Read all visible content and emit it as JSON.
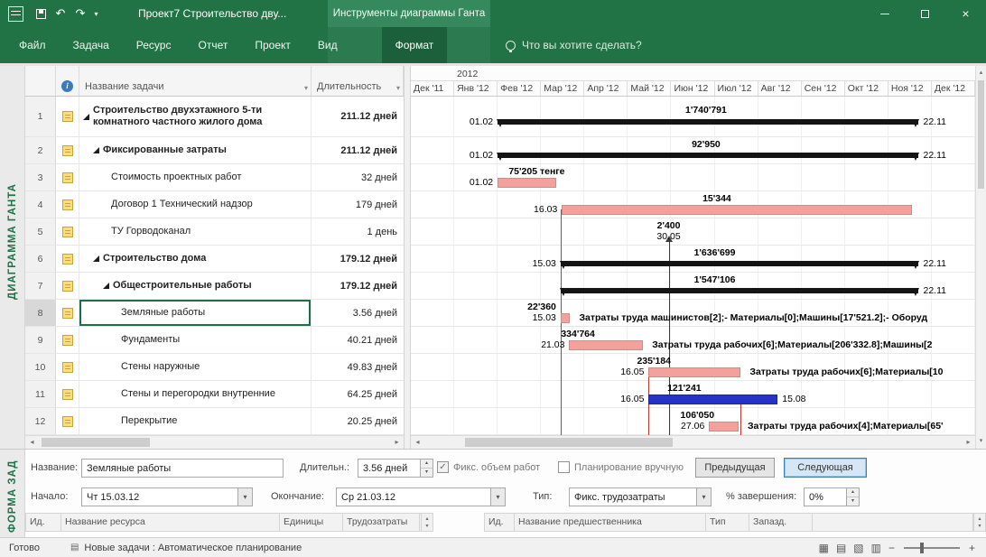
{
  "titlebar": {
    "title": "Проект7 Строительство дву...",
    "context_label": "Инструменты диаграммы Ганта"
  },
  "ribbon": {
    "tabs": [
      "Файл",
      "Задача",
      "Ресурс",
      "Отчет",
      "Проект",
      "Вид",
      "Формат"
    ],
    "active_tab": "Формат",
    "search_hint": "Что вы хотите сделать?"
  },
  "view_labels": {
    "top": "ДИАГРАММА ГАНТА",
    "bottom": "ФОРМА ЗАД"
  },
  "table": {
    "columns": {
      "name": "Название задачи",
      "duration": "Длительность"
    },
    "rows": [
      {
        "num": 1,
        "level": 0,
        "summary": true,
        "selected": false,
        "name": "Строительство двухэтажного 5-ти комнатного частного жилого дома",
        "duration": "211.12 дней"
      },
      {
        "num": 2,
        "level": 1,
        "summary": true,
        "selected": false,
        "name": "Фиксированные затраты",
        "duration": "211.12 дней"
      },
      {
        "num": 3,
        "level": 2,
        "summary": false,
        "selected": false,
        "name": "Стоимость проектных работ",
        "duration": "32 дней"
      },
      {
        "num": 4,
        "level": 2,
        "summary": false,
        "selected": false,
        "name": "Договор 1 Технический надзор",
        "duration": "179 дней"
      },
      {
        "num": 5,
        "level": 2,
        "summary": false,
        "selected": false,
        "name": "ТУ Горводоканал",
        "duration": "1 день"
      },
      {
        "num": 6,
        "level": 1,
        "summary": true,
        "selected": false,
        "name": "Строительство дома",
        "duration": "179.12 дней"
      },
      {
        "num": 7,
        "level": 2,
        "summary": true,
        "selected": false,
        "name": "Общестроительные работы",
        "duration": "179.12 дней"
      },
      {
        "num": 8,
        "level": 3,
        "summary": false,
        "selected": true,
        "name": "Земляные работы",
        "duration": "3.56 дней"
      },
      {
        "num": 9,
        "level": 3,
        "summary": false,
        "selected": false,
        "name": "Фундаменты",
        "duration": "40.21 дней"
      },
      {
        "num": 10,
        "level": 3,
        "summary": false,
        "selected": false,
        "name": "Стены наружные",
        "duration": "49.83 дней"
      },
      {
        "num": 11,
        "level": 3,
        "summary": false,
        "selected": false,
        "name": "Стены и перегородки внутренние",
        "duration": "64.25 дней"
      },
      {
        "num": 12,
        "level": 3,
        "summary": false,
        "selected": false,
        "name": "Перекрытие",
        "duration": "20.25 дней"
      }
    ]
  },
  "timeline": {
    "year": "2012",
    "months": [
      "Дек '11",
      "Янв '12",
      "Фев '12",
      "Мар '12",
      "Апр '12",
      "Май '12",
      "Июн '12",
      "Июл '12",
      "Авг '12",
      "Сен '12",
      "Окт '12",
      "Ноя '12",
      "Дек '12"
    ]
  },
  "gantt": {
    "bars": [
      {
        "row": 1,
        "type": "summary",
        "s": 2.0,
        "e": 11.7,
        "lm": 6.8,
        "above": "1'740'791",
        "left": "01.02",
        "right": "22.11"
      },
      {
        "row": 2,
        "type": "summary",
        "s": 2.0,
        "e": 11.7,
        "lm": 6.8,
        "above": "92'950",
        "left": "01.02",
        "right": "22.11"
      },
      {
        "row": 3,
        "type": "task",
        "s": 2.0,
        "e": 3.35,
        "lm": 2.9,
        "above": "75'205 тенге",
        "left": "01.02"
      },
      {
        "row": 4,
        "type": "task",
        "s": 3.48,
        "e": 11.55,
        "lm": 7.05,
        "above": "15'344",
        "left": "16.03"
      },
      {
        "row": 5,
        "type": "labels",
        "c": 5.94,
        "above": "2'400",
        "below": "30.05"
      },
      {
        "row": 6,
        "type": "summary",
        "s": 3.45,
        "e": 11.7,
        "lm": 7.0,
        "above": "1'636'699",
        "left": "15.03",
        "right": "22.11"
      },
      {
        "row": 7,
        "type": "summary",
        "s": 3.45,
        "e": 11.7,
        "lm": 7.0,
        "above": "1'547'106",
        "right": "22.11"
      },
      {
        "row": 8,
        "type": "task",
        "s": 3.45,
        "e": 3.67,
        "left": "15.03",
        "left2": "22'360",
        "rtext": "Затраты труда машинистов[2];- Материалы[0];Машины[17'521.2];- Оборуд"
      },
      {
        "row": 9,
        "type": "task",
        "s": 3.65,
        "e": 5.35,
        "lm": 3.85,
        "above": "334'764",
        "left": "21.03",
        "rtext": "Затраты труда рабочих[6];Материалы[206'332.8];Машины[2"
      },
      {
        "row": 10,
        "type": "task",
        "s": 5.48,
        "e": 7.6,
        "lm": 5.6,
        "above": "235'184",
        "left": "16.05",
        "rtext": "Затраты труда рабочих[6];Материалы[10"
      },
      {
        "row": 11,
        "type": "taskblue",
        "s": 5.48,
        "e": 8.45,
        "lm": 6.3,
        "above": "121'241",
        "left": "16.05",
        "right": "15.08"
      },
      {
        "row": 12,
        "type": "task",
        "s": 6.87,
        "e": 7.55,
        "lm": 6.6,
        "above": "106'050",
        "left": "27.06",
        "rtext": "Затраты труда рабочих[4];Материалы[65'"
      }
    ],
    "links": [
      {
        "m": 3.45,
        "from": 4,
        "to": 12,
        "color": "red"
      },
      {
        "m": 5.48,
        "from": 10,
        "to": 12,
        "color": "red"
      },
      {
        "m": 7.6,
        "from": 11,
        "to": 12,
        "color": "red"
      },
      {
        "m": 5.94,
        "from": 5,
        "to": 12,
        "color": "dark",
        "arrow": true
      }
    ]
  },
  "form": {
    "name_label": "Название:",
    "name_value": "Земляные работы",
    "duration_label": "Длительн.:",
    "duration_value": "3.56 дней",
    "fixed_work_label": "Фикс. объем работ",
    "fixed_work_checked": true,
    "manual_label": "Планирование вручную",
    "manual_checked": false,
    "prev_button": "Предыдущая",
    "next_button": "Следующая",
    "start_label": "Начало:",
    "start_value": "Чт 15.03.12",
    "finish_label": "Окончание:",
    "finish_value": "Ср 21.03.12",
    "type_label": "Тип:",
    "type_value": "Фикс. трудозатраты",
    "percent_label": "% завершения:",
    "percent_value": "0%",
    "resource_grid_headers": [
      "Ид.",
      "Название ресурса",
      "Единицы",
      "Трудозатраты"
    ],
    "predecessor_grid_headers": [
      "Ид.",
      "Название предшественника",
      "Тип",
      "Запазд."
    ]
  },
  "statusbar": {
    "ready": "Готово",
    "autoschedule": "Новые задачи : Автоматическое планирование"
  },
  "icons": {
    "undo": "↶",
    "redo": "↷",
    "menu_down": "▾",
    "close": "×",
    "filter": "▾",
    "scroll_left": "◂",
    "scroll_right": "▸",
    "scroll_up": "▴",
    "scroll_down": "▾",
    "gantt_view": "▦",
    "usage_view": "▤",
    "board_view": "▧",
    "sheet_view": "▥",
    "zoom_out": "−",
    "zoom_in": "+",
    "check": "✓",
    "info": "i",
    "status_mode": "▤",
    "spin_up": "▴",
    "spin_down": "▾"
  },
  "colors": {
    "accent_green": "#217346",
    "task_pink": "#f2a19c",
    "task_blue": "#2633c8",
    "summary_black": "#141414",
    "link_red": "#c4372e"
  }
}
